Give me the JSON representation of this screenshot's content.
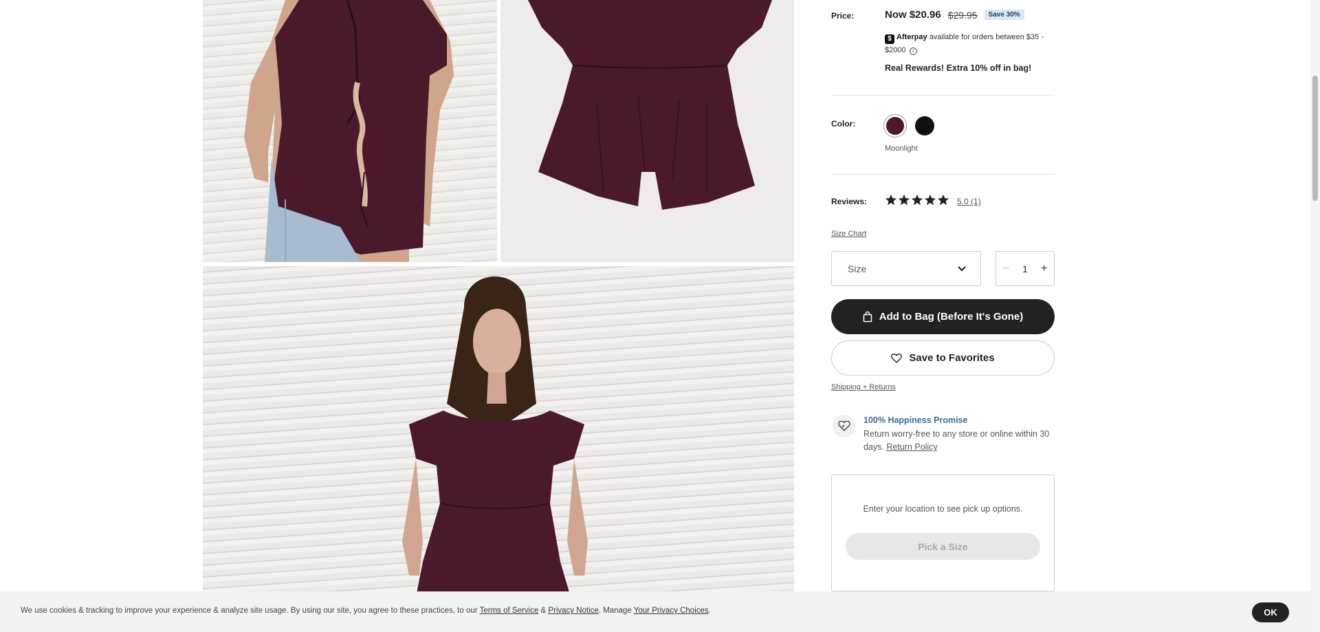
{
  "product": {
    "price_label": "Price:",
    "now_price": "Now $20.96",
    "original_price": "$29.95",
    "save_badge": "Save 30%",
    "afterpay_logo": "$",
    "afterpay_brand": "Afterpay",
    "afterpay_text": "available for orders between $35 - $2000",
    "info_glyph": "i",
    "rewards": "Real Rewards! Extra 10% off in bag!",
    "color_label": "Color:",
    "colors": [
      {
        "name": "Moonlight",
        "hex": "#4a1a2a",
        "selected": true
      },
      {
        "name": "Black",
        "hex": "#111111",
        "selected": false
      }
    ],
    "selected_color_name": "Moonlight",
    "reviews_label": "Reviews:",
    "rating_value": 5,
    "rating_text": "5.0",
    "review_count": "(1)",
    "size_chart": "Size Chart",
    "size_placeholder": "Size",
    "quantity": "1",
    "qty_minus": "−",
    "qty_plus": "+",
    "add_to_bag": "Add to Bag (Before It's Gone)",
    "save_favorites": "Save to Favorites",
    "shipping_link": "Shipping + Returns",
    "promise_title": "100% Happiness Promise",
    "promise_text": "Return worry-free to any store or online within 30 days.",
    "return_policy": "Return Policy",
    "pickup_text": "Enter your location to see pick up options.",
    "pickup_button": "Pick a Size"
  },
  "cookie": {
    "text_before": "We use cookies & tracking to improve your experience & analyze site usage. By using our site, you agree to these practices, to our",
    "terms": "Terms of Service",
    "amp": "&",
    "privacy": "Privacy Notice",
    "manage": ". Manage",
    "choices": "Your Privacy Choices",
    "period": ".",
    "ok": "OK"
  },
  "colors": {
    "accent_blue": "#3d6a99",
    "button_dark": "#222222",
    "product_maroon": "#4a1a2a"
  }
}
